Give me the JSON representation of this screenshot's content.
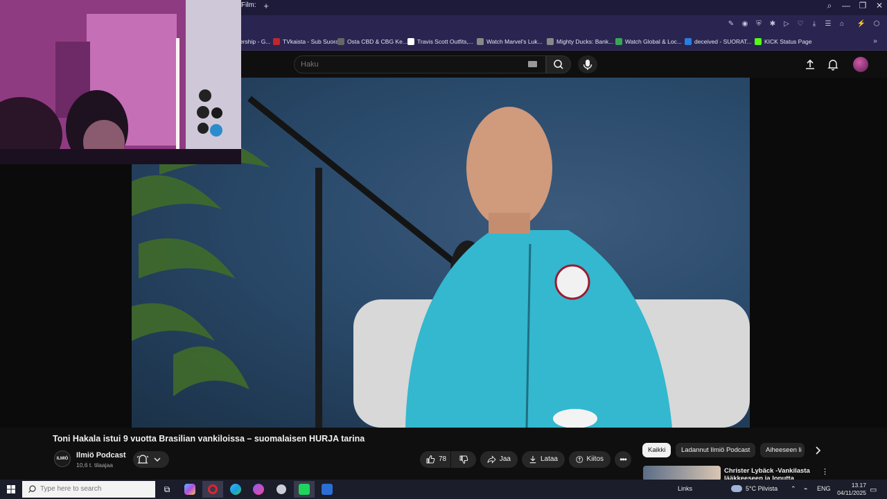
{
  "browser": {
    "active_tab_label": "Film:",
    "new_tab_label": "+",
    "window_controls": {
      "search": "⌕",
      "minimize": "—",
      "restore": "❐",
      "close": "✕"
    }
  },
  "bookmarks": [
    {
      "label": "ership - G...",
      "color": "#3d3d3d"
    },
    {
      "label": "TVkaista - Sub Suora",
      "color": "#c0262d"
    },
    {
      "label": "Osta CBD & CBG Ke...",
      "color": "#666666"
    },
    {
      "label": "Travis Scott Outfits,...",
      "color": "#ffffff"
    },
    {
      "label": "Watch Marvel's Luk...",
      "color": "#888888"
    },
    {
      "label": "Mighty Ducks: Bank...",
      "color": "#888888"
    },
    {
      "label": "Watch Global & Loc...",
      "color": "#3aa655"
    },
    {
      "label": "deceived - SUORAT...",
      "color": "#2a7de1"
    },
    {
      "label": "KICK Status Page",
      "color": "#53fc18"
    }
  ],
  "search": {
    "placeholder": "Haku"
  },
  "video": {
    "title": "Toni Hakala istui 9 vuotta Brasilian vankiloissa – suomalaisen HURJA tarina",
    "channel_name": "Ilmiö Podcast",
    "channel_avatar_text": "ILMIÖ",
    "subscribers": "10,6 t. tilaajaa",
    "likes": "78",
    "share_label": "Jaa",
    "download_label": "Lataa",
    "thanks_label": "Kiitos"
  },
  "chips": [
    "Kaikki",
    "Ladannut Ilmiö Podcast",
    "Aiheeseen li"
  ],
  "recommendation": {
    "title": "Christer Lybäck -Vankilasta lääkkeeseen ja loputta kiuraukset"
  },
  "taskbar": {
    "search_placeholder": "Type here to search",
    "links_label": "Links",
    "weather": "5°C  Pilvista",
    "language": "ENG",
    "time": "13.17",
    "date": "04/11/2025"
  },
  "colors": {
    "accent_red": "#ff0000",
    "bg": "#0f0f0f",
    "chip_bg": "#272727",
    "tab_bar": "#1e1a3a"
  }
}
